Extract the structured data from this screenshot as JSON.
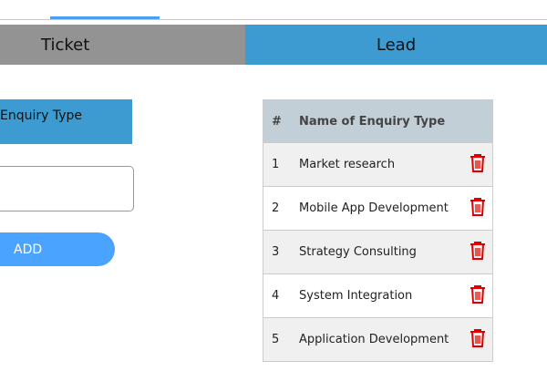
{
  "tabs": [
    {
      "label": "Ticket"
    },
    {
      "label": "Lead"
    }
  ],
  "form": {
    "label": "Enquiry Type",
    "input_value": "",
    "add_label": "ADD"
  },
  "table": {
    "headers": [
      "#",
      "Name of Enquiry Type"
    ],
    "rows": [
      {
        "num": "1",
        "name": "Market research"
      },
      {
        "num": "2",
        "name": "Mobile App Development"
      },
      {
        "num": "3",
        "name": "Strategy Consulting"
      },
      {
        "num": "4",
        "name": "System Integration"
      },
      {
        "num": "5",
        "name": "Application Development"
      }
    ]
  },
  "colors": {
    "accent": "#3d9bd2",
    "delete": "#e00000"
  }
}
